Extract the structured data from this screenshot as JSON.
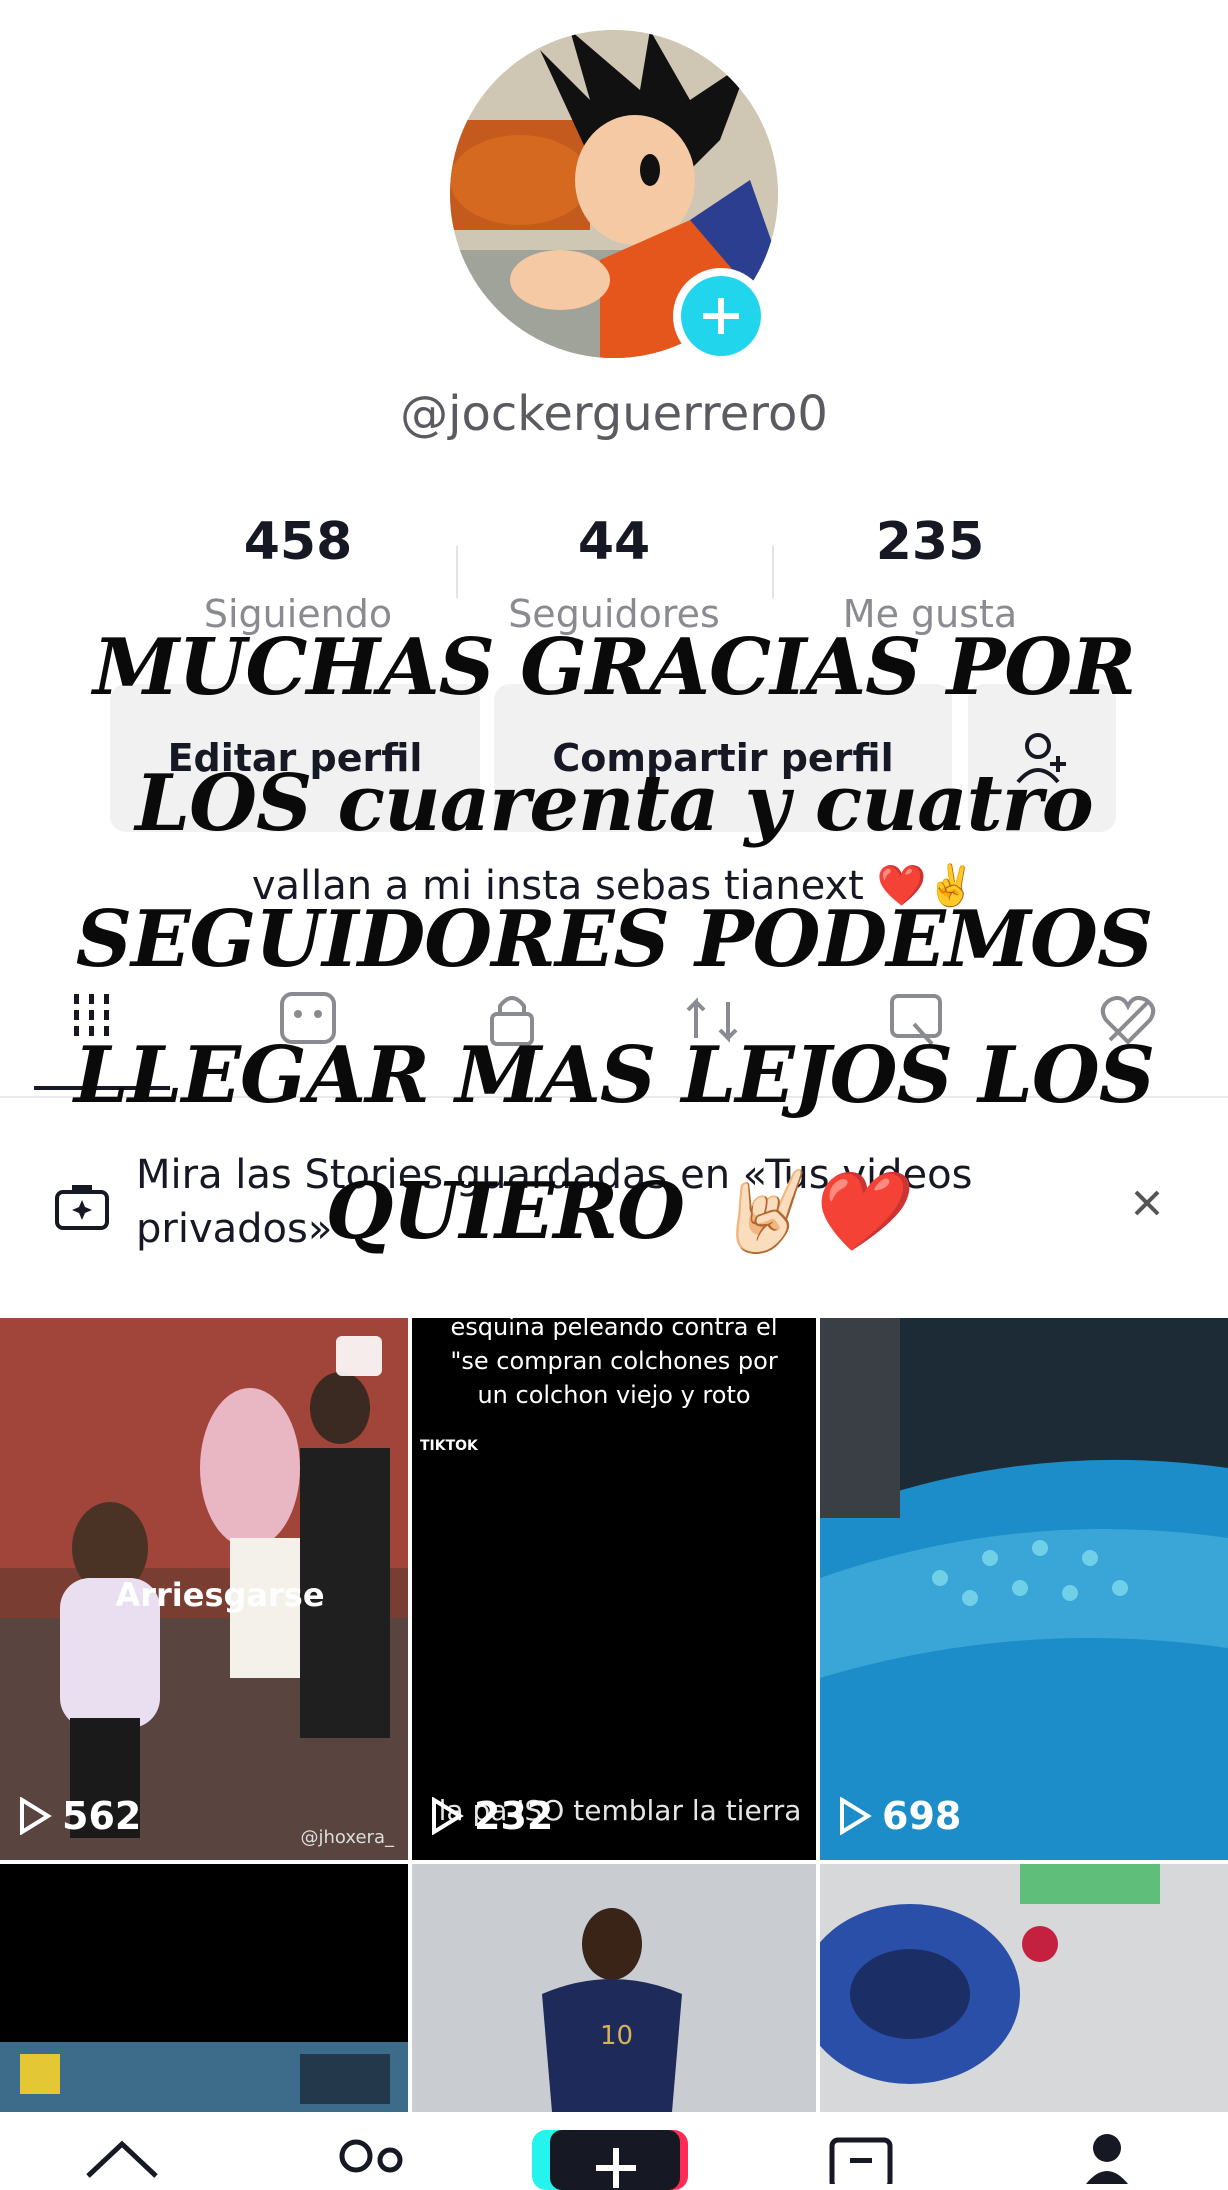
{
  "profile": {
    "username": "@jockerguerrero0",
    "stats": [
      {
        "value": "458",
        "label": "Siguiendo"
      },
      {
        "value": "44",
        "label": "Seguidores"
      },
      {
        "value": "235",
        "label": "Me gusta"
      }
    ],
    "buttons": {
      "edit": "Editar perfil",
      "share": "Compartir perfil"
    },
    "bio": "vallan a mi insta sebas tianext ❤️✌️"
  },
  "banner": {
    "text": "Mira las Stories guardadas en «Tus videos privados»"
  },
  "overlay": {
    "text": "MUCHAS GRACIAS POR LOS cuarenta y cuatro SEGUIDORES PODEMOS LLEGAR MAS LEJOS LOS QUIERO 🤘🏻❤️"
  },
  "videos": [
    {
      "views": "562",
      "caption": "Arriesgarse",
      "watermark": "@jhoxera_"
    },
    {
      "views": "232",
      "caption_top": "esquina peleando contra el \"se compran colchones por un colchon viejo y roto",
      "caption_bottom": "la pa ISO temblar la tierra",
      "watermark": "TIKTOK"
    },
    {
      "views": "698"
    },
    {},
    {},
    {}
  ],
  "colors": {
    "accent": "#20d5ec",
    "text": "#161823",
    "muted": "#8a8b91",
    "tiktok_red": "#fe2c55"
  }
}
